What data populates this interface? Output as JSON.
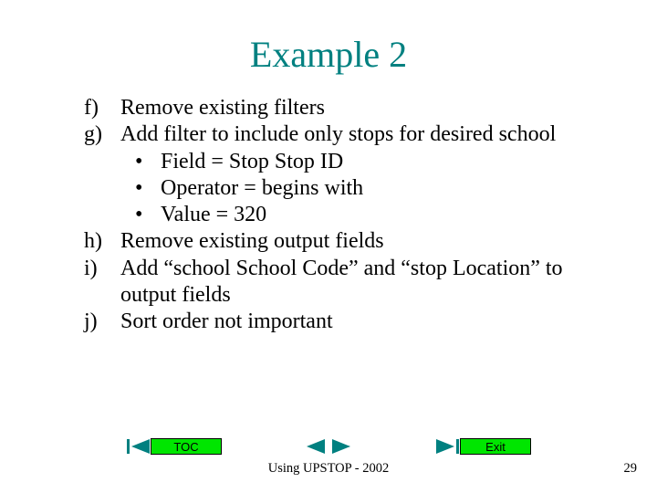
{
  "title": "Example 2",
  "items": {
    "f": {
      "marker": "f)",
      "text": "Remove existing filters"
    },
    "g": {
      "marker": "g)",
      "text": "Add filter to include only stops for desired school"
    },
    "g_sub": {
      "a": "Field = Stop Stop ID",
      "b": "Operator = begins with",
      "c": "Value = 320"
    },
    "h": {
      "marker": "h)",
      "text": "Remove existing output fields"
    },
    "i": {
      "marker": "i)",
      "text": "Add “school School Code” and “stop Location” to output fields"
    },
    "j": {
      "marker": "j)",
      "text": "Sort order not important"
    }
  },
  "nav": {
    "toc": "TOC",
    "exit": "Exit"
  },
  "footer": "Using UPSTOP - 2002",
  "page": "29",
  "colors": {
    "teal": "#008080",
    "green": "#00e600"
  }
}
